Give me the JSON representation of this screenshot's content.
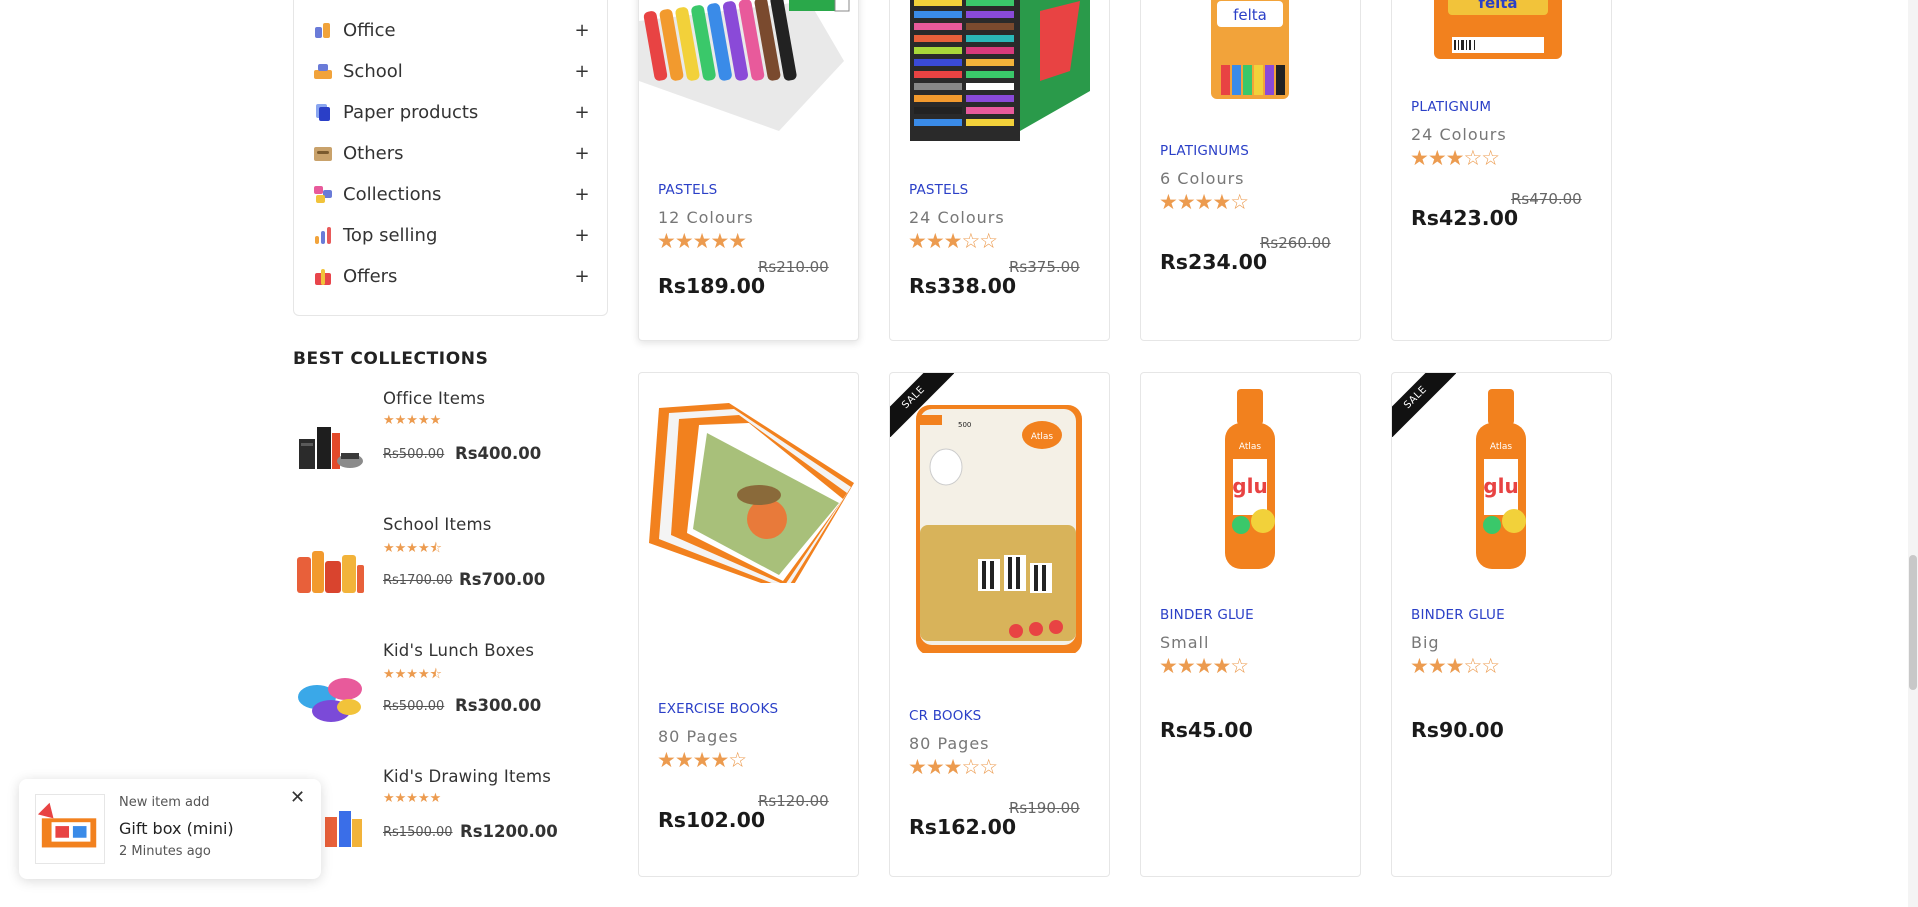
{
  "categories": [
    {
      "label": "Office",
      "icon": "office-icon"
    },
    {
      "label": "School",
      "icon": "school-icon"
    },
    {
      "label": "Paper products",
      "icon": "paper-products-icon"
    },
    {
      "label": "Others",
      "icon": "others-icon"
    },
    {
      "label": "Collections",
      "icon": "collections-icon"
    },
    {
      "label": "Top selling",
      "icon": "top-selling-icon"
    },
    {
      "label": "Offers",
      "icon": "offers-icon"
    }
  ],
  "expand_symbol": "+",
  "best_collections": {
    "title": "BEST COLLECTIONS",
    "items": [
      {
        "name": "Office Items",
        "stars": "★★★★★",
        "old_price": "Rs500.00",
        "price": "Rs400.00"
      },
      {
        "name": "School Items",
        "stars": "★★★★⯪",
        "old_price": "Rs1700.00",
        "price": "Rs700.00"
      },
      {
        "name": "Kid's Lunch Boxes",
        "stars": "★★★★⯪",
        "old_price": "Rs500.00",
        "price": "Rs300.00"
      },
      {
        "name": "Kid's Drawing Items",
        "stars": "★★★★★",
        "old_price": "Rs1500.00",
        "price": "Rs1200.00"
      }
    ]
  },
  "products": [
    {
      "brand": "PASTELS",
      "name": "12 Colours",
      "rating": 5,
      "stars": "★★★★★",
      "old_price": "Rs210.00",
      "price": "Rs189.00",
      "sale": false
    },
    {
      "brand": "PASTELS",
      "name": "24 Colours",
      "rating": 3,
      "stars": "★★★☆☆",
      "old_price": "Rs375.00",
      "price": "Rs338.00",
      "sale": false
    },
    {
      "brand": "PLATIGNUMS",
      "name": "6 Colours",
      "rating": 4,
      "stars": "★★★★☆",
      "old_price": "Rs260.00",
      "price": "Rs234.00",
      "sale": false
    },
    {
      "brand": "PLATIGNUM",
      "name": "24 Colours",
      "rating": 3,
      "stars": "★★★☆☆",
      "old_price": "Rs470.00",
      "price": "Rs423.00",
      "sale": false
    },
    {
      "brand": "EXERCISE BOOKS",
      "name": "80 Pages",
      "rating": 4,
      "stars": "★★★★☆",
      "old_price": "Rs120.00",
      "price": "Rs102.00",
      "sale": false
    },
    {
      "brand": "CR BOOKS",
      "name": "80 Pages",
      "rating": 3,
      "stars": "★★★☆☆",
      "old_price": "Rs190.00",
      "price": "Rs162.00",
      "sale": true
    },
    {
      "brand": "BINDER GLUE",
      "name": "Small",
      "rating": 4,
      "stars": "★★★★☆",
      "old_price": "",
      "price": "Rs45.00",
      "sale": false
    },
    {
      "brand": "BINDER GLUE",
      "name": "Big",
      "rating": 3,
      "stars": "★★★☆☆",
      "old_price": "",
      "price": "Rs90.00",
      "sale": true
    }
  ],
  "sale_label": "SALE",
  "product_image_text": {
    "felta": "felta",
    "glue": "glu",
    "atlas": "Atlas",
    "pages": "500"
  },
  "toast": {
    "top": "New item add",
    "title": "Gift box (mini)",
    "time": "2 Minutes ago",
    "close": "✕"
  },
  "colors": {
    "accent_brand": "#2a3fc7",
    "star": "#ec9b4f",
    "sale_ribbon": "#111111"
  }
}
